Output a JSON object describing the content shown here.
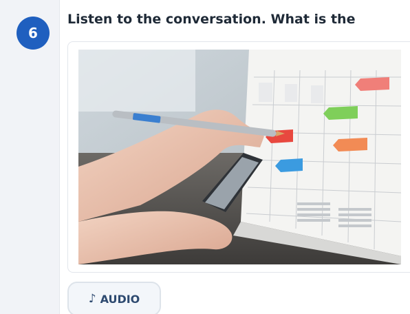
{
  "question": {
    "number": "6",
    "text": "Listen to the conversation. What is the"
  },
  "image": {
    "subject": "Hands marking a desk calendar with a pencil while holding a phone",
    "icon": "photo"
  },
  "audio_button": {
    "icon": "music-note-icon",
    "glyph": "♪",
    "label": "AUDIO"
  },
  "colors": {
    "badge": "#1f5fbf",
    "rail": "#f1f3f7",
    "audio_text": "#2e4a70"
  }
}
